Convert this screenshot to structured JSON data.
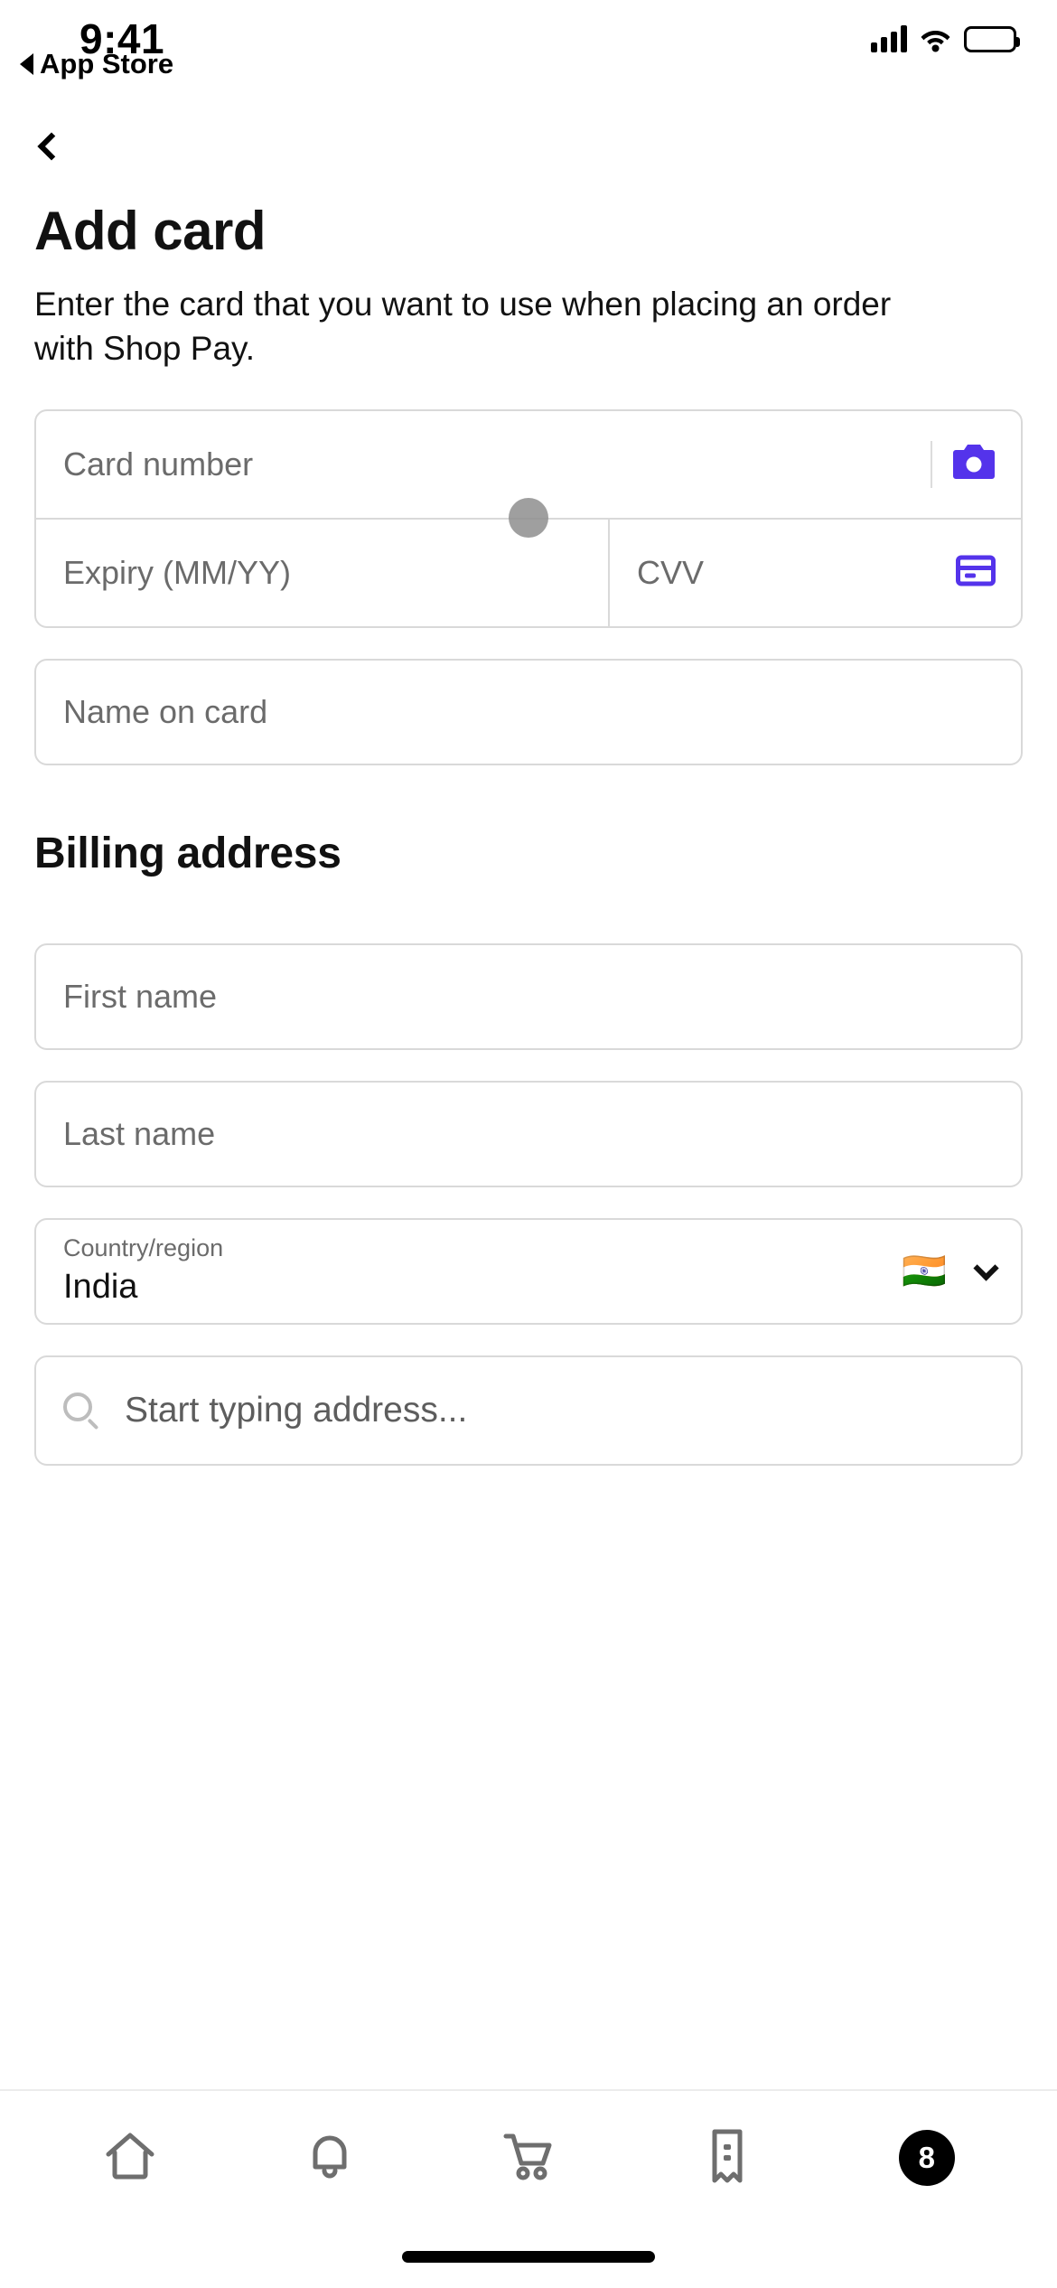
{
  "status_bar": {
    "time": "9:41",
    "back_app_label": "App Store",
    "back_triangle_icon": "triangle-left-icon",
    "signal_icon": "cellular-signal-icon",
    "wifi_icon": "wifi-icon",
    "battery_icon": "battery-full-icon"
  },
  "nav": {
    "back_icon": "chevron-left-icon"
  },
  "header": {
    "title": "Add card",
    "description": "Enter the card that you want to use when placing an order with Shop Pay."
  },
  "card_form": {
    "card_number": {
      "placeholder": "Card number",
      "scan_icon": "camera-icon"
    },
    "expiry": {
      "placeholder": "Expiry (MM/YY)"
    },
    "cvv": {
      "placeholder": "CVV",
      "help_icon": "credit-card-icon"
    },
    "name_on_card": {
      "placeholder": "Name on card"
    }
  },
  "billing": {
    "section_title": "Billing address",
    "first_name": {
      "placeholder": "First name"
    },
    "last_name": {
      "placeholder": "Last name"
    },
    "country": {
      "label": "Country/region",
      "value": "India",
      "flag": "🇮🇳",
      "chevron_icon": "chevron-down-icon"
    },
    "address_search": {
      "placeholder": "Start typing address...",
      "search_icon": "search-icon"
    }
  },
  "tab_bar": {
    "items": [
      {
        "name": "home",
        "icon": "home-icon"
      },
      {
        "name": "notifications",
        "icon": "bell-icon"
      },
      {
        "name": "cart",
        "icon": "shopping-cart-icon"
      },
      {
        "name": "orders",
        "icon": "receipt-icon"
      },
      {
        "name": "account",
        "icon": "count-badge",
        "badge": "8"
      }
    ]
  },
  "colors": {
    "accent": "#5433EB",
    "border": "#d9d9d9",
    "placeholder": "#6b6b6b",
    "text": "#111111"
  }
}
